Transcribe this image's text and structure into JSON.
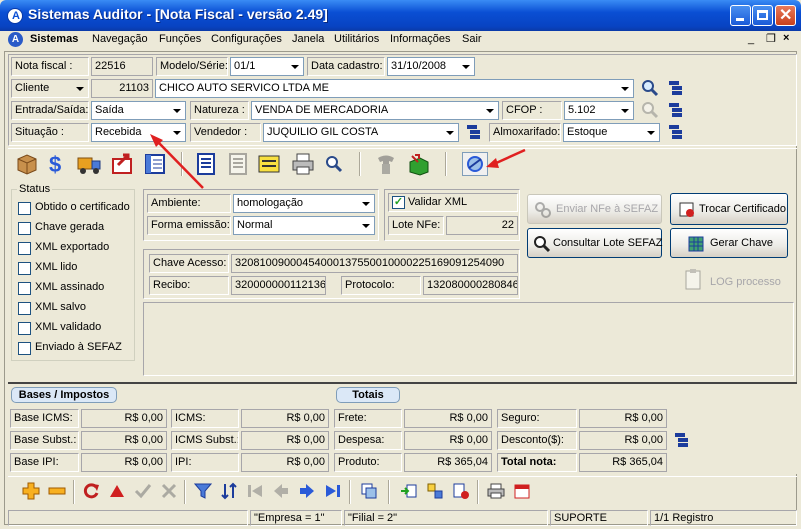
{
  "window": {
    "title": "Sistemas Auditor - [Nota Fiscal - versão 2.49]"
  },
  "menu": [
    "Sistemas",
    "Navegação",
    "Funções",
    "Configurações",
    "Janela",
    "Utilitários",
    "Informações",
    "Sair"
  ],
  "header": {
    "nota_fiscal_label": "Nota fiscal :",
    "nota_fiscal_value": "22516",
    "modelo_label": "Modelo/Série:",
    "modelo_value": "01/1",
    "data_label": "Data cadastro:",
    "data_value": "31/10/2008",
    "cliente_label": "Cliente",
    "cliente_code": "21103",
    "cliente_name": "CHICO AUTO SERVICO LTDA ME",
    "entrada_label": "Entrada/Saída:",
    "entrada_value": "Saída",
    "natureza_label": "Natureza :",
    "natureza_value": "VENDA DE MERCADORIA",
    "cfop_label": "CFOP :",
    "cfop_value": "5.102",
    "situacao_label": "Situação :",
    "situacao_value": "Recebida",
    "vendedor_label": "Vendedor :",
    "vendedor_value": "JUQUILIO GIL COSTA",
    "almox_label": "Almoxarifado:",
    "almox_value": "Estoque"
  },
  "status": {
    "title": "Status",
    "items": [
      "Obtido o certificado",
      "Chave gerada",
      "XML exportado",
      "XML lido",
      "XML assinado",
      "XML salvo",
      "XML validado",
      "Enviado à SEFAZ"
    ]
  },
  "nfe": {
    "ambiente_label": "Ambiente:",
    "ambiente_value": "homologação",
    "forma_label": "Forma emissão:",
    "forma_value": "Normal",
    "validar_label": "Validar XML",
    "lote_label": "Lote NFe:",
    "lote_value": "22",
    "chave_label": "Chave Acesso:",
    "chave_value": "32081009000454000137550010000225169091254090",
    "recibo_label": "Recibo:",
    "recibo_value": "320000000112136",
    "protocolo_label": "Protocolo:",
    "protocolo_value": "132080000280846"
  },
  "buttons": {
    "enviar": "Enviar NFe à SEFAZ",
    "consultar": "Consultar Lote SEFAZ",
    "trocar": "Trocar Certificado",
    "gerar": "Gerar Chave",
    "log": "LOG processo"
  },
  "totals": {
    "bases_title": "Bases / Impostos",
    "totais_title": "Totais",
    "rows": [
      [
        {
          "label": "Base ICMS:",
          "value": "R$ 0,00"
        },
        {
          "label": "ICMS:",
          "value": "R$ 0,00"
        },
        {
          "label": "Frete:",
          "value": "R$ 0,00"
        },
        {
          "label": "Seguro:",
          "value": "R$ 0,00"
        }
      ],
      [
        {
          "label": "Base Subst.:",
          "value": "R$ 0,00"
        },
        {
          "label": "ICMS Subst.:",
          "value": "R$ 0,00"
        },
        {
          "label": "Despesa:",
          "value": "R$ 0,00"
        },
        {
          "label": "Desconto($):",
          "value": "R$ 0,00"
        }
      ],
      [
        {
          "label": "Base IPI:",
          "value": "R$ 0,00"
        },
        {
          "label": "IPI:",
          "value": "R$ 0,00"
        },
        {
          "label": "Produto:",
          "value": "R$ 365,04"
        },
        {
          "label": "Total nota:",
          "value": "R$ 365,04"
        }
      ]
    ]
  },
  "statusbar": {
    "empresa": "\"Empresa = 1\"",
    "filial": "\"Filial = 2\"",
    "user": "SUPORTE",
    "registro": "1/1 Registro"
  },
  "colors": {
    "titlebar": "#0a4fd4",
    "annotation_arrow": "#e02020",
    "menu_bg": "#ece9d8"
  }
}
